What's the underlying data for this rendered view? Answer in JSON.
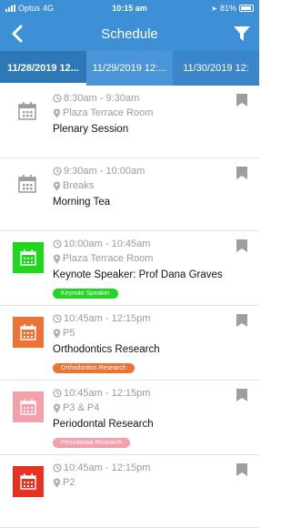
{
  "status_bar": {
    "carrier": "Optus",
    "network": "4G",
    "time": "10:15 am",
    "battery": "81%"
  },
  "header": {
    "title": "Schedule"
  },
  "date_tabs": [
    {
      "label": "11/28/2019 12..."
    },
    {
      "label": "11/29/2019 12:..."
    },
    {
      "label": "11/30/2019 12:"
    }
  ],
  "events": [
    {
      "time": "8:30am - 9:30am",
      "location": "Plaza Terrace Room",
      "title": "Plenary Session",
      "tag": null,
      "color": "#9e9e9e"
    },
    {
      "time": "9:30am - 10:00am",
      "location": "Breaks",
      "title": "Morning Tea",
      "tag": null,
      "color": "#9e9e9e"
    },
    {
      "time": "10:00am - 10:45am",
      "location": "Plaza Terrace Room",
      "title": "Keynote Speaker: Prof Dana Graves",
      "tag": "Keynote Speaker",
      "color": "#1ed71e"
    },
    {
      "time": "10:45am - 12:15pm",
      "location": "P5",
      "title": "Orthodontics Research",
      "tag": "Orthodontics Research",
      "color": "#ec7335"
    },
    {
      "time": "10:45am - 12:15pm",
      "location": "P3 & P4",
      "title": "Periodontal Research",
      "tag": "Periodontal Research",
      "color": "#f4a0aa"
    },
    {
      "time": "10:45am - 12:15pm",
      "location": "P2",
      "title": "",
      "tag": null,
      "color": "#e53222"
    }
  ],
  "colors": {
    "header": "#3d8fd6",
    "active_tab": "#2f78b8",
    "bookmark": "#9e9e9e"
  }
}
